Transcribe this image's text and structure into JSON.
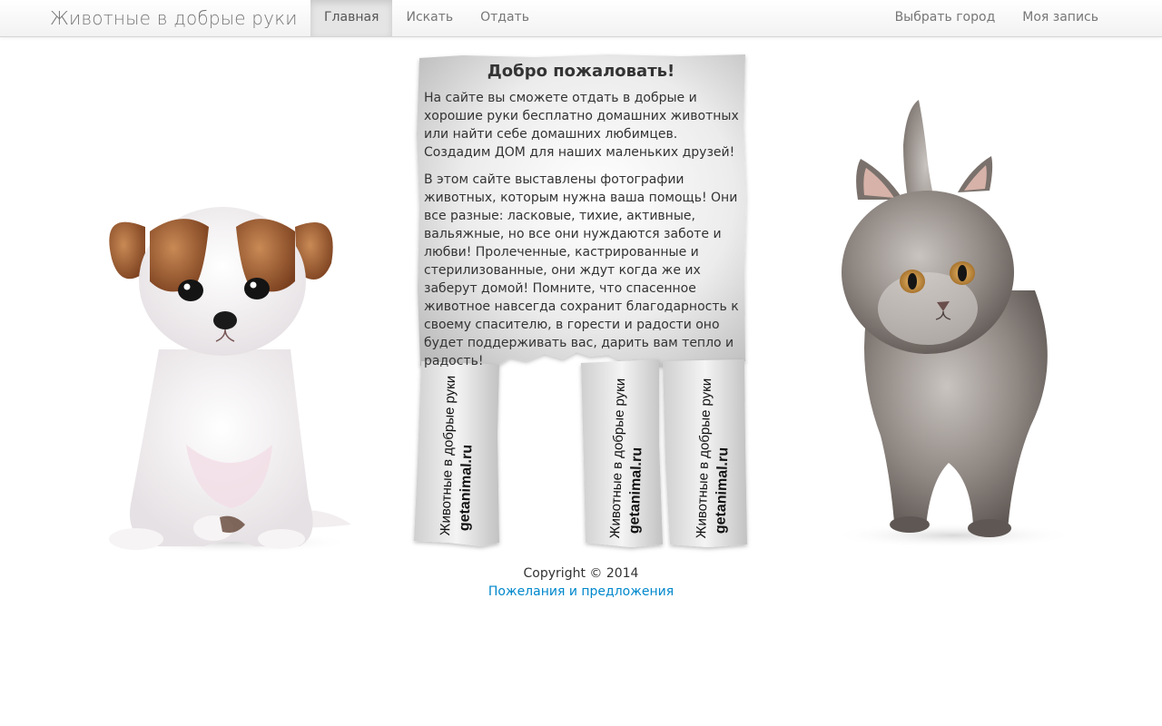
{
  "navbar": {
    "brand": "Животные в добрые руки",
    "left_items": [
      {
        "label": "Главная",
        "active": true
      },
      {
        "label": "Искать",
        "active": false
      },
      {
        "label": "Отдать",
        "active": false
      }
    ],
    "right_items": [
      {
        "label": "Выбрать город"
      },
      {
        "label": "Моя запись"
      }
    ]
  },
  "notice": {
    "title": "Добро пожаловать!",
    "paragraphs": [
      "На сайте вы сможете отдать в добрые и хорошие руки бесплатно домашних животных или найти себе домашних любимцев. Создадим ДОМ для наших маленьких друзей!",
      "В этом сайте выставлены фотографии животных, которым нужна ваша помощь! Они все разные: ласковые, тихие, активные, вальяжные, но все они нуждаются заботе и любви! Пролеченные, кастрированные и стерилизованные, они ждут когда же их заберут домой! Помните, что спасенное животное навсегда сохранит благодарность к своему спасителю, в горести и радости оно будет поддерживать вас, дарить вам тепло и радость!"
    ],
    "tabs": [
      {
        "line1": "Животные в добрые руки",
        "line2": "getanimal.ru"
      },
      {
        "line1": "Животные в добрые руки",
        "line2": "getanimal.ru"
      },
      {
        "line1": "Животные в добрые руки",
        "line2": "getanimal.ru"
      }
    ]
  },
  "images": {
    "left": "puppy",
    "right": "kitten"
  },
  "footer": {
    "copyright": "Copyright © 2014",
    "feedback_link": "Пожелания и предложения"
  },
  "colors": {
    "link": "#0088cc",
    "nav_text": "#777777",
    "text": "#333333"
  }
}
